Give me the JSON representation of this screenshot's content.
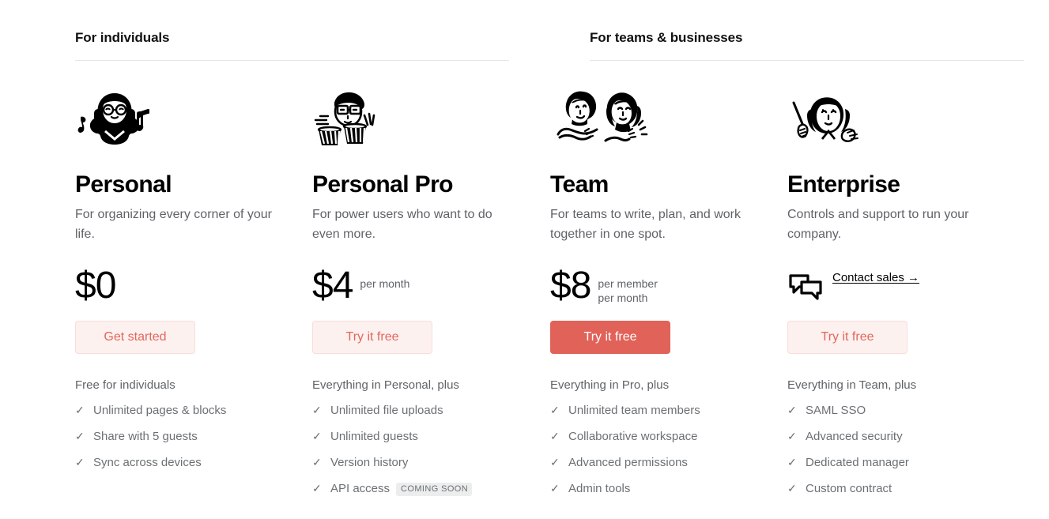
{
  "groups": [
    {
      "title": "For individuals"
    },
    {
      "title": "For teams & businesses"
    }
  ],
  "plans": [
    {
      "illustration": "person-headphones-music-illustration",
      "name": "Personal",
      "description": "For organizing every corner of your life.",
      "price": "$0",
      "price_unit": "",
      "cta": {
        "label": "Get started",
        "style": "ghost"
      },
      "features_head": "Free for individuals",
      "features": [
        {
          "label": "Unlimited pages & blocks",
          "badge": ""
        },
        {
          "label": "Share with 5 guests",
          "badge": ""
        },
        {
          "label": "Sync across devices",
          "badge": ""
        }
      ]
    },
    {
      "illustration": "person-glasses-drums-illustration",
      "name": "Personal Pro",
      "description": "For power users who want to do even more.",
      "price": "$4",
      "price_unit": "per month",
      "cta": {
        "label": "Try it free",
        "style": "ghost"
      },
      "features_head": "Everything in Personal, plus",
      "features": [
        {
          "label": "Unlimited file uploads",
          "badge": ""
        },
        {
          "label": "Unlimited guests",
          "badge": ""
        },
        {
          "label": "Version history",
          "badge": ""
        },
        {
          "label": "API access",
          "badge": "COMING SOON"
        }
      ]
    },
    {
      "illustration": "two-people-working-illustration",
      "name": "Team",
      "description": "For teams to write, plan, and work together in one spot.",
      "price": "$8",
      "price_unit": "per member\nper month",
      "cta": {
        "label": "Try it free",
        "style": "solid"
      },
      "features_head": "Everything in Pro, plus",
      "features": [
        {
          "label": "Unlimited team members",
          "badge": ""
        },
        {
          "label": "Collaborative workspace",
          "badge": ""
        },
        {
          "label": "Advanced permissions",
          "badge": ""
        },
        {
          "label": "Admin tools",
          "badge": ""
        }
      ]
    },
    {
      "illustration": "person-presenting-pointer-illustration",
      "name": "Enterprise",
      "description": "Controls and support to run your company.",
      "contact": {
        "label": "Contact sales →",
        "icon": "speech-bubbles-icon"
      },
      "cta": {
        "label": "Try it free",
        "style": "ghost"
      },
      "features_head": "Everything in Team, plus",
      "features": [
        {
          "label": "SAML SSO",
          "badge": ""
        },
        {
          "label": "Advanced security",
          "badge": ""
        },
        {
          "label": "Dedicated manager",
          "badge": ""
        },
        {
          "label": "Custom contract",
          "badge": ""
        }
      ]
    }
  ],
  "icons": {
    "check": "✓"
  },
  "colors": {
    "accent": "#e16259",
    "accent_soft_bg": "#fdf1ef",
    "accent_soft_border": "#f7ded9",
    "text": "#000000",
    "muted_text": "#5f6368",
    "badge_bg": "#eceded",
    "rule": "#e8e6e3"
  }
}
